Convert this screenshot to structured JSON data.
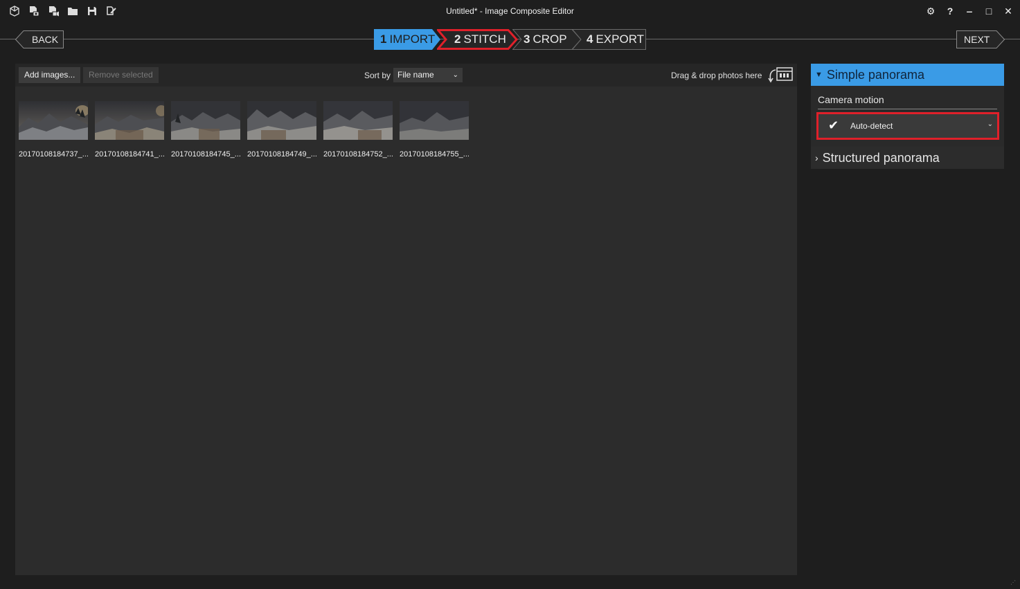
{
  "window": {
    "title": "Untitled* - Image Composite Editor",
    "quick_icons": [
      "new-panorama-icon",
      "new-from-images-icon",
      "new-from-video-icon",
      "open-folder-icon",
      "save-icon",
      "export-icon"
    ],
    "controls": {
      "settings": "⚙",
      "help": "?",
      "minimize": "‒",
      "maximize": "□",
      "close": "✕"
    }
  },
  "nav": {
    "back_label": "BACK",
    "next_label": "NEXT",
    "steps": [
      {
        "num": "1",
        "label": "IMPORT",
        "state": "active",
        "color": "#3a9be6"
      },
      {
        "num": "2",
        "label": "STITCH",
        "state": "highlighted",
        "color": "#e0202a"
      },
      {
        "num": "3",
        "label": "CROP",
        "state": "normal"
      },
      {
        "num": "4",
        "label": "EXPORT",
        "state": "normal"
      }
    ]
  },
  "toolbar": {
    "add_label": "Add images...",
    "remove_label": "Remove selected",
    "sort_label": "Sort by",
    "sort_value": "File name",
    "drop_hint": "Drag & drop photos here"
  },
  "images": [
    {
      "label": "20170108184737_..."
    },
    {
      "label": "20170108184741_..."
    },
    {
      "label": "20170108184745_..."
    },
    {
      "label": "20170108184749_..."
    },
    {
      "label": "20170108184752_..."
    },
    {
      "label": "20170108184755_..."
    }
  ],
  "panel": {
    "simple_title": "Simple panorama",
    "camera_motion_label": "Camera motion",
    "camera_motion_value": "Auto-detect",
    "structured_title": "Structured panorama"
  }
}
